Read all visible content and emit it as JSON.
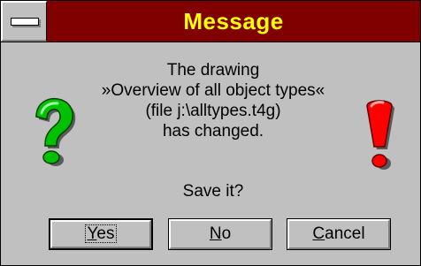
{
  "window": {
    "title": "Message",
    "title_color": "#ffff00",
    "titlebar_color": "#800000",
    "face_color": "#c0c0c0"
  },
  "message": {
    "lines": [
      "The drawing",
      "»Overview of all object types«",
      "(file j:\\alltypes.t4g)",
      "has changed."
    ],
    "question": "Save it?"
  },
  "icons": {
    "left": "question-mark-icon",
    "left_color": "#00c000",
    "right": "exclamation-mark-icon",
    "right_color": "#ff0000"
  },
  "buttons": {
    "yes": {
      "mnemonic": "Y",
      "rest": "es"
    },
    "no": {
      "mnemonic": "N",
      "rest": "o"
    },
    "cancel": {
      "mnemonic": "C",
      "rest": "ancel"
    }
  }
}
